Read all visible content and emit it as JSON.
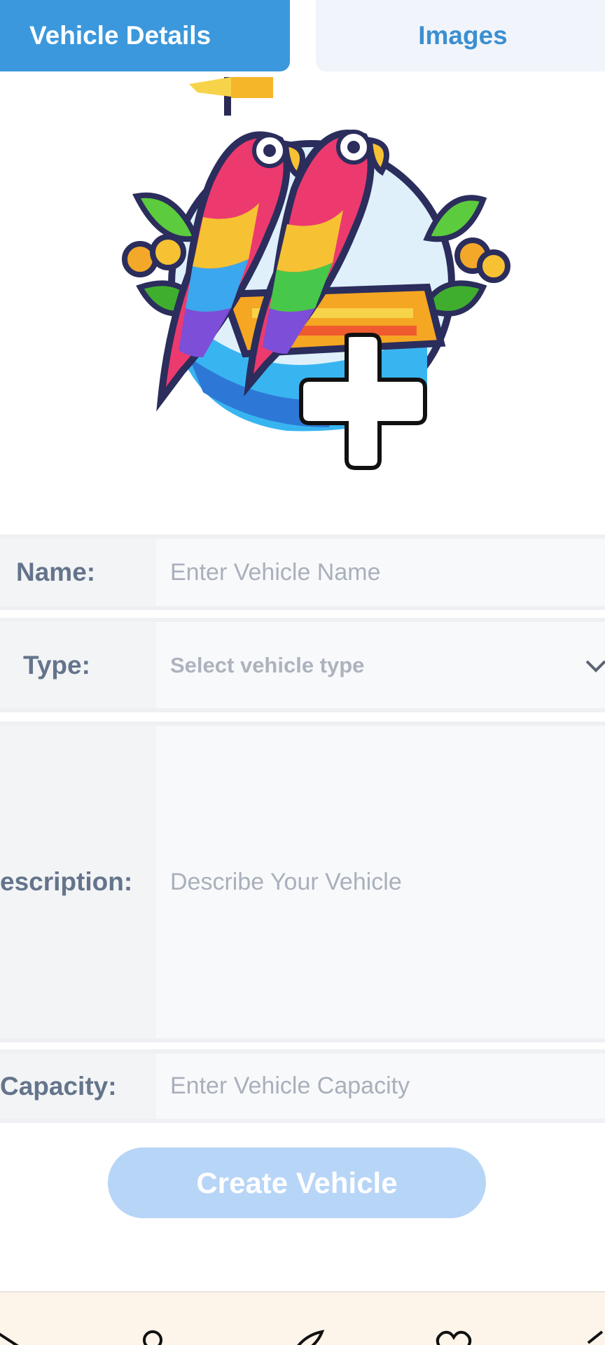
{
  "tabs": [
    {
      "label": "Vehicle Details",
      "active": true
    },
    {
      "label": "Images",
      "active": false
    }
  ],
  "image_upload": {
    "icon": "plus-icon",
    "logo": "parrots-logo"
  },
  "form": {
    "name": {
      "label": "Name:",
      "placeholder": "Enter Vehicle Name"
    },
    "type": {
      "label": "Type:",
      "placeholder": "Select vehicle type"
    },
    "description": {
      "label": "escription:",
      "placeholder": "Describe Your Vehicle"
    },
    "capacity": {
      "label": "Capacity:",
      "placeholder": "Enter Vehicle Capacity"
    }
  },
  "actions": {
    "create_label": "Create Vehicle"
  },
  "bottom_nav": {
    "icons": [
      "nav-icon-1",
      "user-icon",
      "send-icon",
      "heart-icon",
      "nav-icon-5"
    ]
  },
  "colors": {
    "accent": "#3b98dc",
    "button_disabled": "#b7d5f7",
    "nav_bg": "#fdf4ea"
  }
}
